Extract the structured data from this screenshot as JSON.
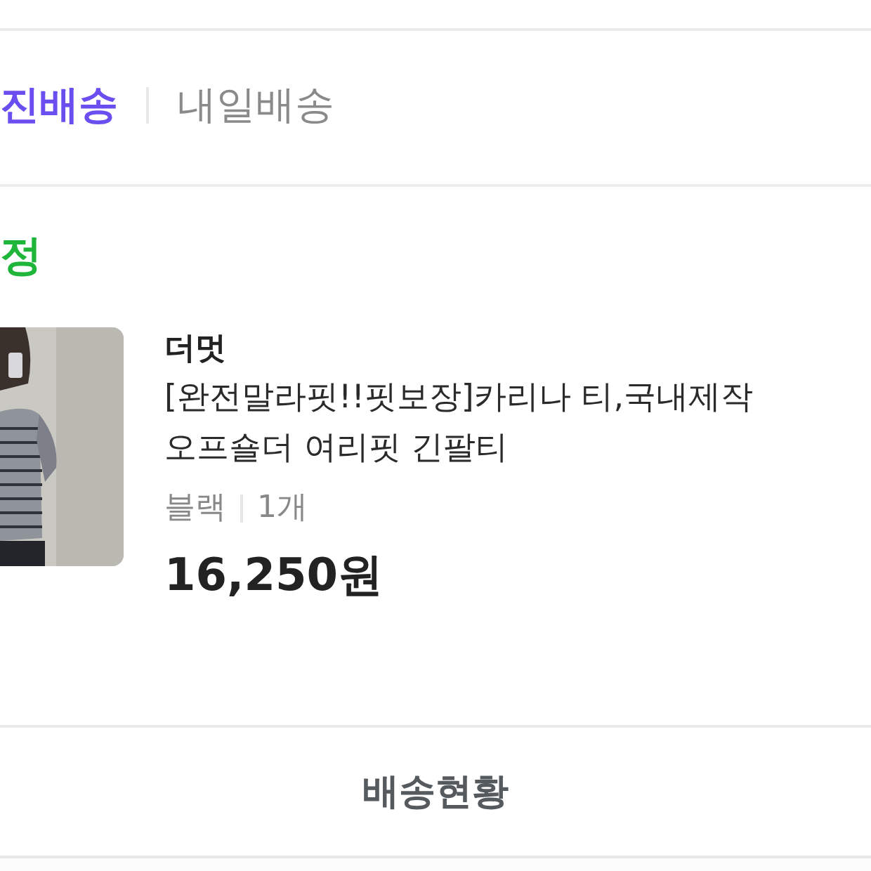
{
  "tabs": [
    {
      "label": "진배송",
      "selected": true
    },
    {
      "label": "내일배송",
      "selected": false
    }
  ],
  "status": {
    "label": "정"
  },
  "product": {
    "brand": "더멋",
    "title_lines": [
      "[완전말라핏!!핏보장]카리나 티,국내제작",
      "오프숄더 여리핏 긴팔티"
    ],
    "option": "블랙",
    "quantity": "1개",
    "price": "16,250원"
  },
  "buttons": [
    "배송현황"
  ]
}
